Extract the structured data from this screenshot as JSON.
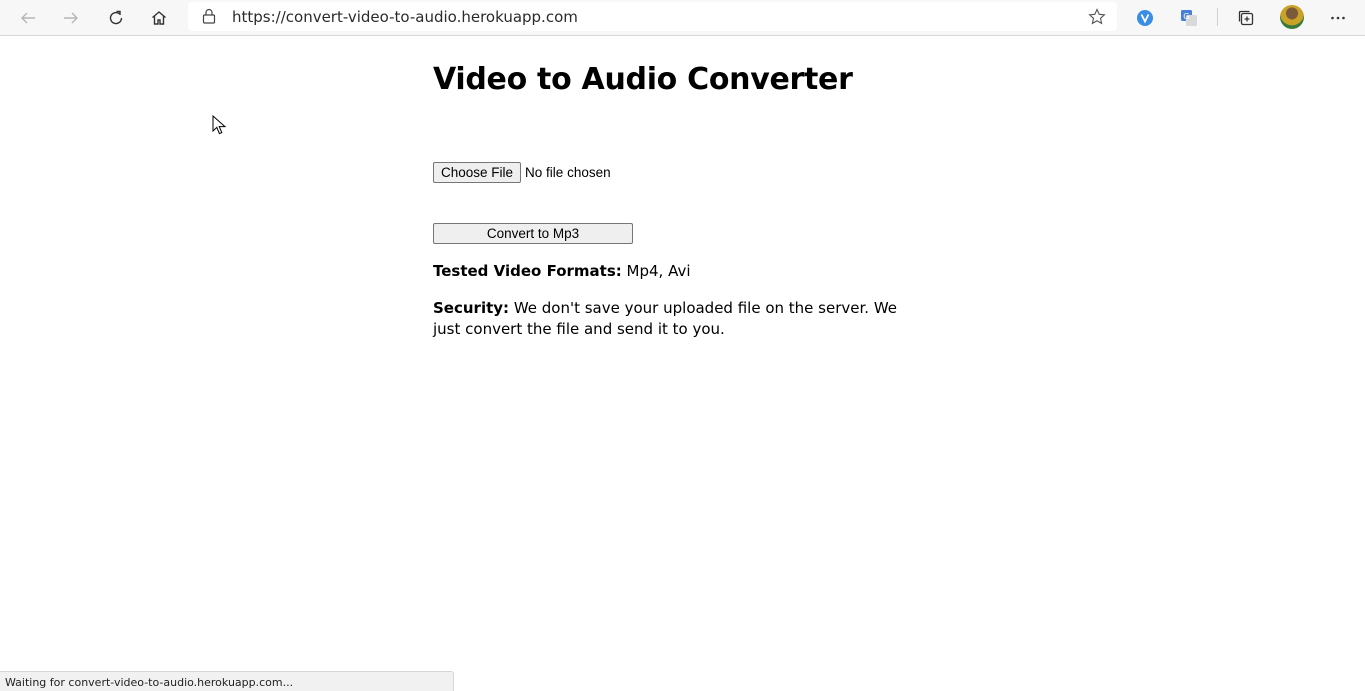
{
  "browser": {
    "url": "https://convert-video-to-audio.herokuapp.com",
    "status_text": "Waiting for convert-video-to-audio.herokuapp.com...",
    "icons": {
      "back": "back-arrow-icon",
      "forward": "forward-arrow-icon",
      "refresh": "refresh-icon",
      "home": "home-icon",
      "lock": "lock-icon",
      "favorite": "star-icon",
      "extension1": "extension-v-icon",
      "extension2": "translate-icon",
      "collections": "collections-icon",
      "profile": "avatar",
      "menu": "more-icon"
    }
  },
  "page": {
    "title": "Video to Audio Converter",
    "file_input": {
      "button_label": "Choose File",
      "status": "No file chosen"
    },
    "convert_button": "Convert to Mp3",
    "formats": {
      "label": "Tested Video Formats:",
      "value": " Mp4, Avi"
    },
    "security": {
      "label": "Security:",
      "value": " We don't save your uploaded file on the server. We just convert the file and send it to you."
    }
  },
  "colors": {
    "toolbar_bg": "#f7f7f7",
    "extension_blue": "#3a8ee6",
    "translate_blue": "#4a7fd6"
  }
}
